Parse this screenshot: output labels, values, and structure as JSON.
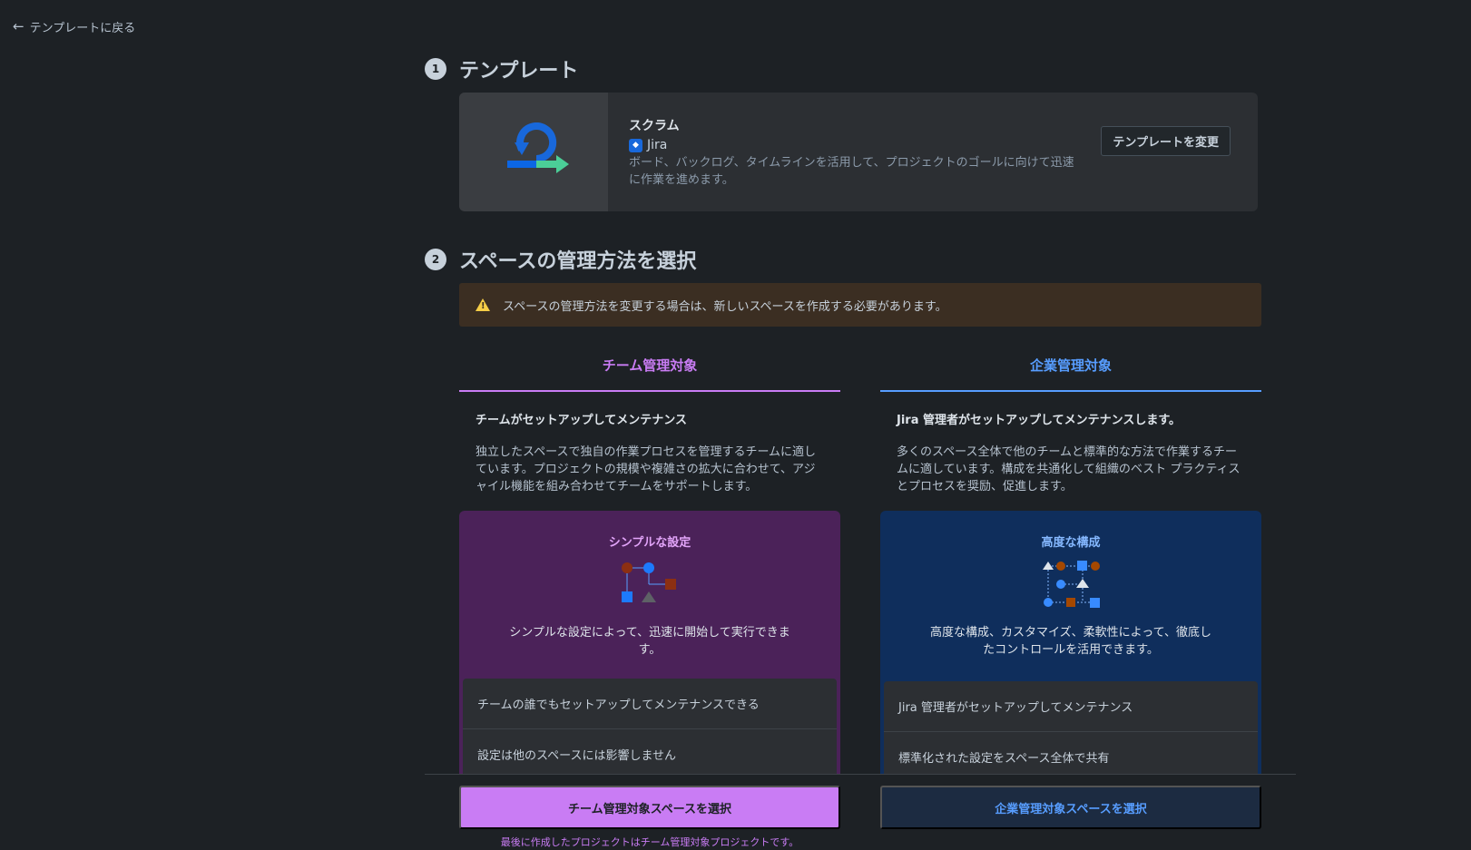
{
  "nav": {
    "back_label": "テンプレートに戻る"
  },
  "step1": {
    "number": "1",
    "title": "テンプレート"
  },
  "template": {
    "name": "スクラム",
    "product": "Jira",
    "description": "ボード、バックログ、タイムラインを活用して、プロジェクトのゴールに向けて迅速に作業を進めます。",
    "change_button": "テンプレートを変更"
  },
  "step2": {
    "number": "2",
    "title": "スペースの管理方法を選択"
  },
  "warning": {
    "text": "スペースの管理方法を変更する場合は、新しいスペースを作成する必要があります。"
  },
  "team": {
    "tab": "チーム管理対象",
    "heading": "チームがセットアップしてメンテナンス",
    "body": "独立したスペースで独自の作業プロセスを管理するチームに適しています。プロジェクトの規模や複雑さの拡大に合わせて、アジャイル機能を組み合わせてチームをサポートします。",
    "card_title": "シンプルな設定",
    "card_desc": "シンプルな設定によって、迅速に開始して実行できます。",
    "items": [
      "チームの誰でもセットアップしてメンテナンスできる",
      "設定は他のスペースには影響しません"
    ],
    "select_button": "チーム管理対象スペースを選択",
    "note": "最後に作成したプロジェクトはチーム管理対象プロジェクトです。"
  },
  "enterprise": {
    "tab": "企業管理対象",
    "heading": "Jira 管理者がセットアップしてメンテナンスします。",
    "body": "多くのスペース全体で他のチームと標準的な方法で作業するチームに適しています。構成を共通化して組織のベスト プラクティスとプロセスを奨励、促進します。",
    "card_title": "高度な構成",
    "card_desc": "高度な構成、カスタマイズ、柔軟性によって、徹底したコントロールを活用できます。",
    "items": [
      "Jira 管理者がセットアップしてメンテナンス",
      "標準化された設定をスペース全体で共有"
    ],
    "select_button": "企業管理対象スペースを選択"
  },
  "colors": {
    "team_accent": "#c97cf4",
    "enterprise_accent": "#579dff",
    "warning": "#f5cd47"
  }
}
